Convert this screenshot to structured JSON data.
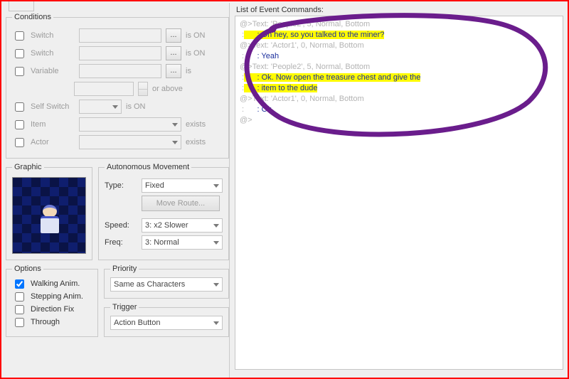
{
  "conditions": {
    "legend": "Conditions",
    "switch1": {
      "label": "Switch",
      "value": "",
      "tail": "is ON"
    },
    "switch2": {
      "label": "Switch",
      "value": "",
      "tail": "is ON"
    },
    "variable": {
      "label": "Variable",
      "value": "",
      "tail": "is"
    },
    "variable_amount": {
      "value": "",
      "tail": "or above"
    },
    "self_switch": {
      "label": "Self Switch",
      "value": "",
      "tail": "is ON"
    },
    "item": {
      "label": "Item",
      "value": "",
      "tail": "exists"
    },
    "actor": {
      "label": "Actor",
      "value": "",
      "tail": "exists"
    }
  },
  "graphic": {
    "legend": "Graphic"
  },
  "autonomous": {
    "legend": "Autonomous Movement",
    "type_label": "Type:",
    "type_value": "Fixed",
    "move_route_btn": "Move Route...",
    "speed_label": "Speed:",
    "speed_value": "3: x2 Slower",
    "freq_label": "Freq:",
    "freq_value": "3: Normal"
  },
  "options": {
    "legend": "Options",
    "walking": "Walking Anim.",
    "stepping": "Stepping Anim.",
    "direction_fix": "Direction Fix",
    "through": "Through"
  },
  "priority": {
    "legend": "Priority",
    "value": "Same as Characters"
  },
  "trigger": {
    "legend": "Trigger",
    "value": "Action Button"
  },
  "event_list": {
    "label": "List of Event Commands:",
    "lines": [
      {
        "prefix": "@>",
        "cmd": "Text: 'People2', 5, Normal, Bottom",
        "dlg": "",
        "highlight": false
      },
      {
        "prefix": " :",
        "cmd": "",
        "dlg": "      : Oh hey, so you talked to the miner?",
        "highlight": true
      },
      {
        "prefix": "@>",
        "cmd": "Text: 'Actor1', 0, Normal, Bottom",
        "dlg": "",
        "highlight": false
      },
      {
        "prefix": " :",
        "cmd": "",
        "dlg": "      : Yeah",
        "highlight": false
      },
      {
        "prefix": "@>",
        "cmd": "Text: 'People2', 5, Normal, Bottom",
        "dlg": "",
        "highlight": false
      },
      {
        "prefix": " :",
        "cmd": "",
        "dlg": "      : Ok. Now open the treasure chest and give the",
        "highlight": true
      },
      {
        "prefix": " :",
        "cmd": "",
        "dlg": "      : item to the dude",
        "highlight": true
      },
      {
        "prefix": "@>",
        "cmd": "Text: 'Actor1', 0, Normal, Bottom",
        "dlg": "",
        "highlight": false
      },
      {
        "prefix": " :",
        "cmd": "",
        "dlg": "      : Ok",
        "highlight": false
      },
      {
        "prefix": "@>",
        "cmd": "",
        "dlg": "",
        "highlight": false
      }
    ]
  },
  "ellipsis": "..."
}
